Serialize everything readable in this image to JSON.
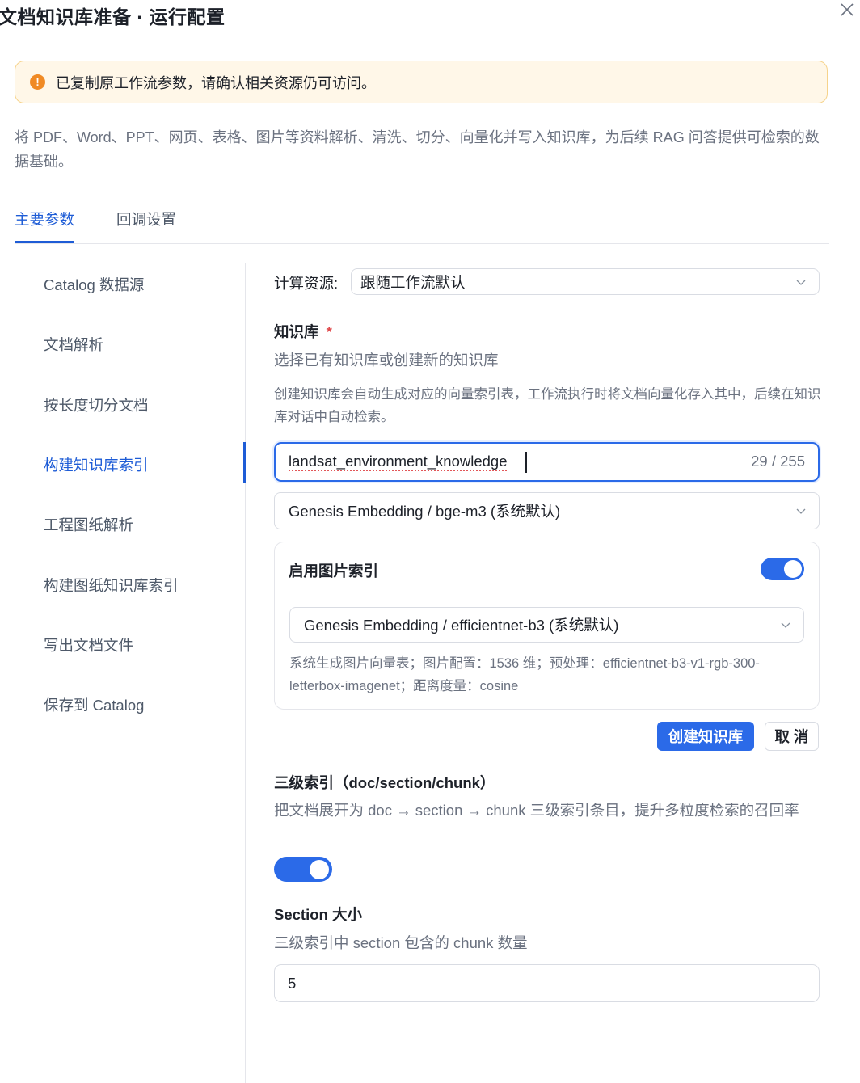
{
  "header": {
    "title": "文档知识库准备 · 运行配置"
  },
  "alert": {
    "icon": "!",
    "text": "已复制原工作流参数，请确认相关资源仍可访问。"
  },
  "description": "将 PDF、Word、PPT、网页、表格、图片等资料解析、清洗、切分、向量化并写入知识库，为后续 RAG 问答提供可检索的数据基础。",
  "tabs": [
    {
      "label": "主要参数",
      "active": true
    },
    {
      "label": "回调设置",
      "active": false
    }
  ],
  "sidebar": {
    "items": [
      {
        "label": "Catalog 数据源"
      },
      {
        "label": "文档解析"
      },
      {
        "label": "按长度切分文档"
      },
      {
        "label": "构建知识库索引",
        "active": true
      },
      {
        "label": "工程图纸解析"
      },
      {
        "label": "构建图纸知识库索引"
      },
      {
        "label": "写出文档文件"
      },
      {
        "label": "保存到 Catalog"
      }
    ]
  },
  "form": {
    "compute": {
      "label": "计算资源:",
      "value": "跟随工作流默认"
    },
    "kb": {
      "label": "知识库",
      "required_mark": "*",
      "subtitle": "选择已有知识库或创建新的知识库",
      "hint": "创建知识库会自动生成对应的向量索引表，工作流执行时将文档向量化存入其中，后续在知识库对话中自动检索。",
      "name_value": "landsat_environment_knowledge",
      "name_count": "29 / 255",
      "embedding_model": "Genesis Embedding / bge-m3 (系统默认)",
      "image_index": {
        "label": "启用图片索引",
        "enabled": true,
        "model": "Genesis Embedding / efficientnet-b3 (系统默认)",
        "info": "系统生成图片向量表；图片配置：1536 维；预处理：efficientnet-b3-v1-rgb-300-letterbox-imagenet；距离度量：cosine"
      },
      "create_button": "创建知识库",
      "cancel_button": "取 消"
    },
    "three_level": {
      "label": "三级索引（doc/section/chunk）",
      "desc": "把文档展开为 doc → section → chunk 三级索引条目，提升多粒度检索的召回率",
      "enabled": true
    },
    "section_size": {
      "label": "Section 大小",
      "desc": "三级索引中 section 包含的 chunk 数量",
      "value": "5"
    }
  },
  "colors": {
    "primary": "#2b6ae8",
    "warning_bg": "#fff7e8",
    "warning_border": "#f6d38b",
    "warning_icon": "#f08a24"
  }
}
